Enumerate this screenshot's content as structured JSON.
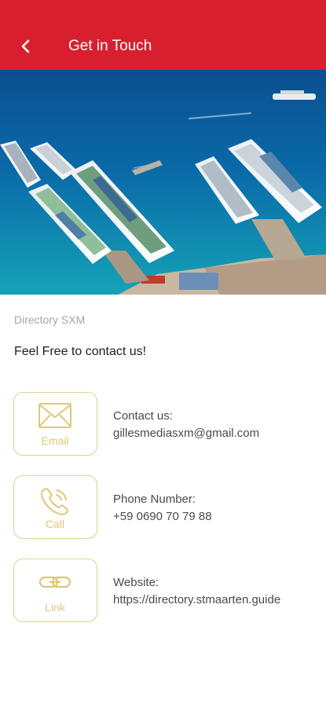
{
  "header": {
    "title": "Get in Touch",
    "background": "#d91f2e",
    "back_icon": "chevron-left-icon"
  },
  "hero": {
    "description_icon": "cruise-port-photo"
  },
  "brand": "Directory SXM",
  "tagline": "Feel Free to contact us!",
  "accent_color": "#dcc77a",
  "contacts": [
    {
      "action_label": "Email",
      "icon": "envelope-icon",
      "heading": "Contact us:",
      "value": "gillesmediasxm@gmail.com"
    },
    {
      "action_label": "Call",
      "icon": "phone-icon",
      "heading": "Phone Number:",
      "value": "+59 0690 70 79 88"
    },
    {
      "action_label": "Link",
      "icon": "link-icon",
      "heading": "Website:",
      "value": "https://directory.stmaarten.guide"
    }
  ]
}
